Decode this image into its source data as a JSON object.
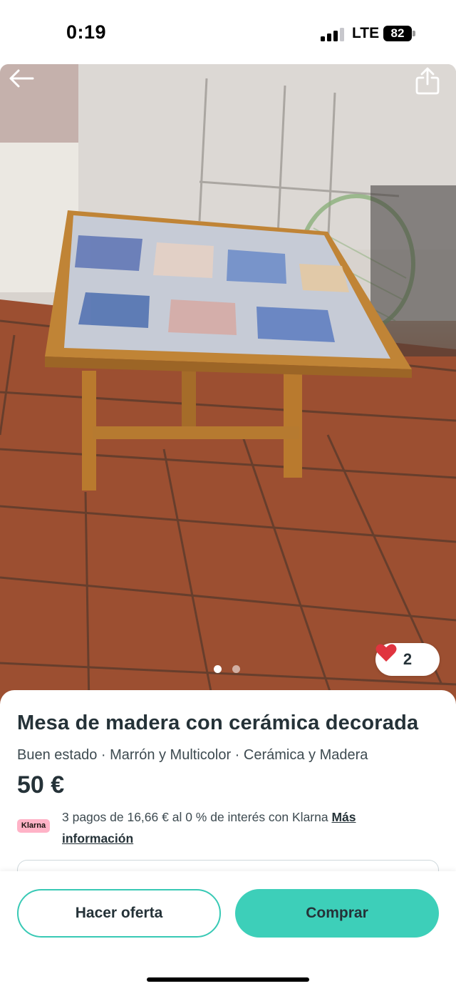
{
  "status_bar": {
    "time": "0:19",
    "network": "LTE",
    "battery": "82"
  },
  "listing": {
    "title": "Mesa de madera con cerámica decorada",
    "attributes": "Buen estado · Marrón y Multicolor · Cerámica y Madera",
    "price": "50 €",
    "likes": "2",
    "photo_count": 2,
    "photo_active_index": 1
  },
  "klarna": {
    "badge": "Klarna",
    "text": "3 pagos de 16,66 € al 0 % de interés con Klarna",
    "link": "Más información"
  },
  "actions": {
    "offer": "Hacer oferta",
    "buy": "Comprar"
  },
  "icons": {
    "back": "back-arrow-icon",
    "share": "share-icon",
    "heart": "heart-icon"
  },
  "colors": {
    "accent": "#3dcfb9",
    "heart": "#e0343f",
    "klarna_pink": "#ffb3c7",
    "text": "#253238"
  }
}
